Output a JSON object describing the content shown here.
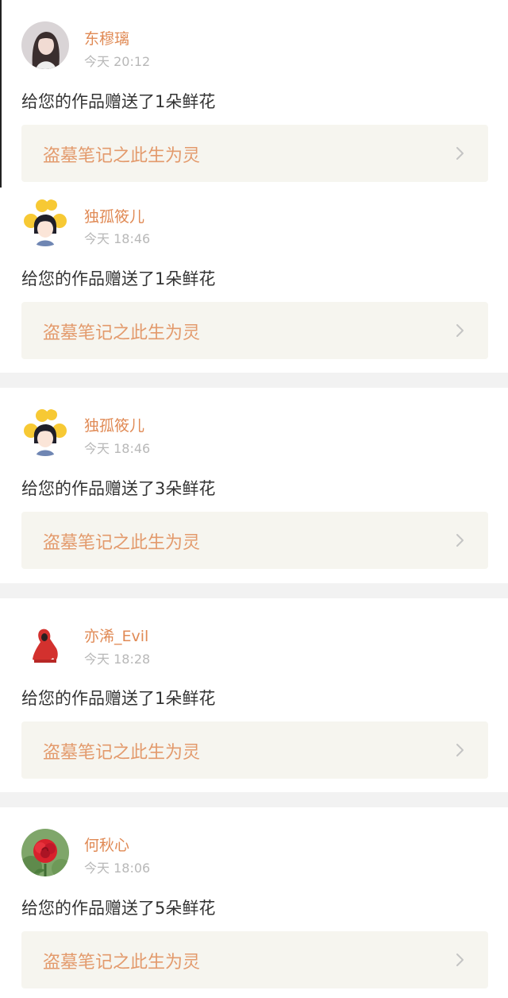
{
  "notifications": [
    {
      "user": "东穆璃",
      "time": "今天 20:12",
      "message": "给您的作品赠送了1朵鲜花",
      "work_title": "盗墓笔记之此生为灵",
      "avatar_icon": "girl-portrait-avatar-icon"
    },
    {
      "user": "独孤筱儿",
      "time": "今天 18:46",
      "message": "给您的作品赠送了1朵鲜花",
      "work_title": "盗墓笔记之此生为灵",
      "avatar_icon": "cartoon-girl-avatar-icon"
    },
    {
      "user": "独孤筱儿",
      "time": "今天 18:46",
      "message": "给您的作品赠送了3朵鲜花",
      "work_title": "盗墓笔记之此生为灵",
      "avatar_icon": "cartoon-girl-avatar-icon"
    },
    {
      "user": "亦浠_Evil",
      "time": "今天 18:28",
      "message": "给您的作品赠送了1朵鲜花",
      "work_title": "盗墓笔记之此生为灵",
      "avatar_icon": "red-hood-figure-avatar-icon"
    },
    {
      "user": "何秋心",
      "time": "今天 18:06",
      "message": "给您的作品赠送了5朵鲜花",
      "work_title": "盗墓笔记之此生为灵",
      "avatar_icon": "red-rose-avatar-icon"
    }
  ],
  "colors": {
    "username": "#e08a55",
    "work_title": "#e39a6c",
    "link_background": "#f6f5ef",
    "separator": "#f2f2f2"
  }
}
